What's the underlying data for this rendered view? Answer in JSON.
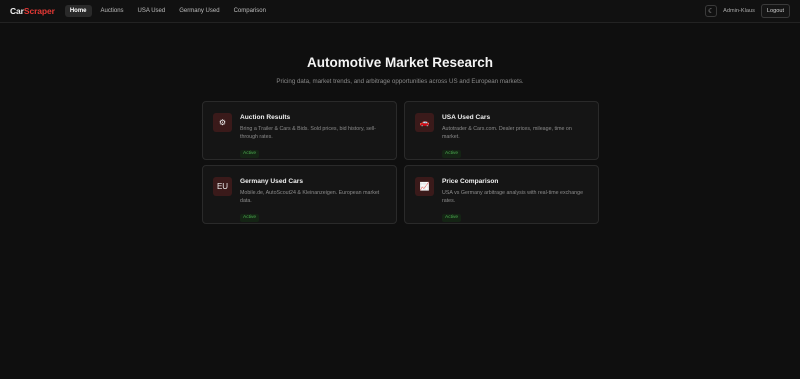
{
  "brand": {
    "part1": "Car",
    "part2": "Scraper"
  },
  "nav": {
    "links": [
      {
        "label": "Home"
      },
      {
        "label": "Auctions"
      },
      {
        "label": "USA Used"
      },
      {
        "label": "Germany Used"
      },
      {
        "label": "Comparison"
      }
    ],
    "active_index": 0,
    "theme_toggle_icon": "moon-icon",
    "user": "Admin-Klaus",
    "logout_label": "Logout"
  },
  "hero": {
    "title": "Automotive Market Research",
    "subtitle": "Pricing data, market trends, and arbitrage opportunities across US and European markets."
  },
  "cards": [
    {
      "icon": "gear-icon",
      "icon_glyph": "⚙",
      "title": "Auction Results",
      "description": "Bring a Trailer & Cars & Bids. Sold prices, bid history, sell-through rates.",
      "status": "Active"
    },
    {
      "icon": "car-icon",
      "icon_glyph": "🚗",
      "title": "USA Used Cars",
      "description": "Autotrader & Cars.com. Dealer prices, mileage, time on market.",
      "status": "Active"
    },
    {
      "icon": "eu-icon",
      "icon_glyph": "EU",
      "title": "Germany Used Cars",
      "description": "Mobile.de, AutoScout24 & Kleinanzeigen. European market data.",
      "status": "Active"
    },
    {
      "icon": "chart-icon",
      "icon_glyph": "📈",
      "title": "Price Comparison",
      "description": "USA vs Germany arbitrage analysis with real-time exchange rates.",
      "status": "Active"
    }
  ],
  "colors": {
    "accent": "#e53935",
    "background": "#0f0f0f",
    "card": "#151515",
    "status_active": "#4caf50"
  }
}
